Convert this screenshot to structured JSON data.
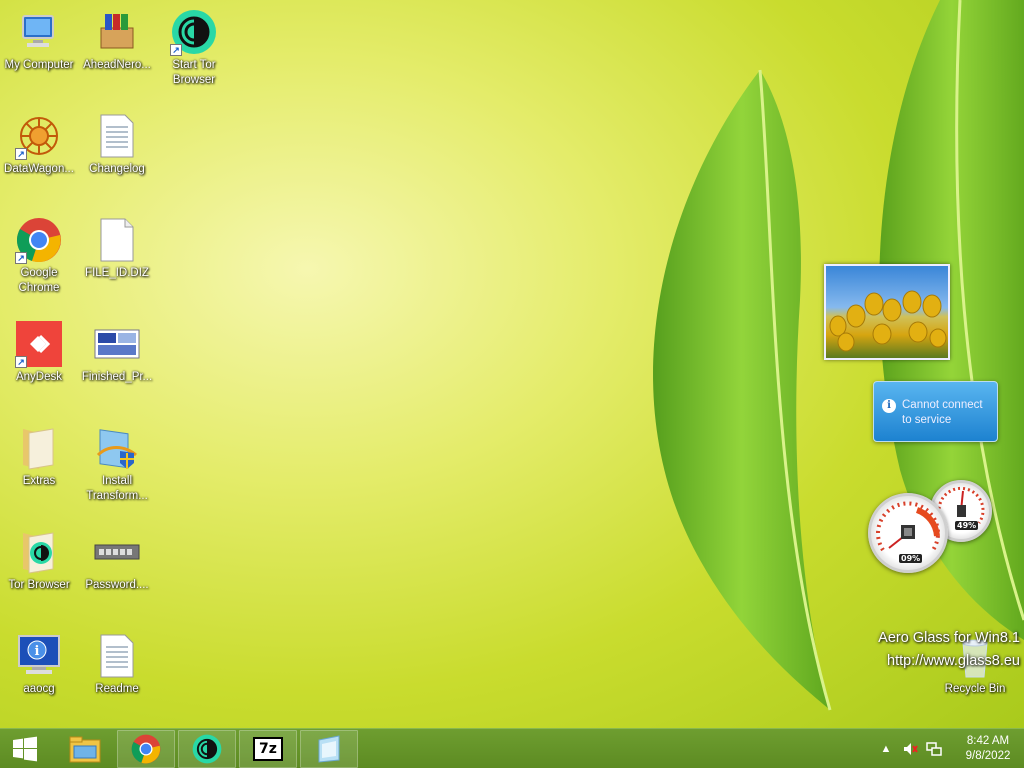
{
  "desktop_icons": [
    {
      "label": "My Computer",
      "icon": "computer-icon"
    },
    {
      "label": "AheadNero...",
      "icon": "nero-package-icon"
    },
    {
      "label": "Start Tor Browser",
      "icon": "tor-icon"
    },
    {
      "label": "DataWagon...",
      "icon": "datawagon-icon"
    },
    {
      "label": "Changelog",
      "icon": "text-file-icon"
    },
    {
      "label": "Google Chrome",
      "icon": "chrome-icon"
    },
    {
      "label": "FILE_ID.DIZ",
      "icon": "blank-file-icon"
    },
    {
      "label": "AnyDesk",
      "icon": "anydesk-icon"
    },
    {
      "label": "Finished_Pr...",
      "icon": "image-file-icon"
    },
    {
      "label": "Extras",
      "icon": "folder-icon"
    },
    {
      "label": "Install Transform...",
      "icon": "installer-icon"
    },
    {
      "label": "Tor Browser",
      "icon": "tor-folder-icon"
    },
    {
      "label": "Password....",
      "icon": "password-icon"
    },
    {
      "label": "aaocg",
      "icon": "monitor-info-icon"
    },
    {
      "label": "Readme",
      "icon": "text-file-icon"
    },
    {
      "label": "Recycle Bin",
      "icon": "recycle-bin-icon"
    }
  ],
  "gadgets": {
    "weather_message": "Cannot connect to service",
    "cpu_value": "09%",
    "memory_value": "49%"
  },
  "watermark": {
    "line1": "Aero Glass for Win8.1",
    "line2": "http://www.glass8.eu"
  },
  "taskbar": {
    "pinned": [
      "file-explorer-icon",
      "chrome-icon",
      "tor-icon",
      "7zip-icon",
      "app-icon"
    ],
    "sevenzip_label": "7z",
    "clock_time": "8:42 AM",
    "clock_date": "9/8/2022"
  },
  "colors": {
    "taskbar": "#6a9a2c",
    "wallpaper_light": "#f6f7b0",
    "wallpaper_dark": "#a6c81a"
  }
}
